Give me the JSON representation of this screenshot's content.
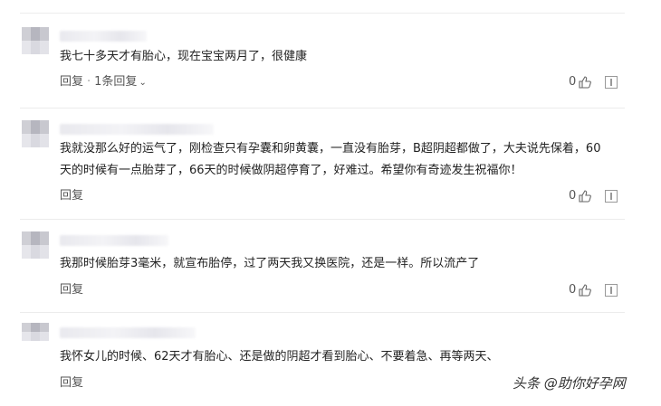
{
  "comments": [
    {
      "text": "我七十多天才有胎心，现在宝宝两月了，很健康",
      "reply_label": "回复",
      "replies_label": "1条回复",
      "likes": "0"
    },
    {
      "text": "我就没那么好的运气了，刚检查只有孕囊和卵黄囊，一直没有胎芽，B超阴超都做了，大夫说先保着，60天的时候有一点胎芽了，66天的时候做阴超停育了，好难过。希望你有奇迹发生祝福你！",
      "reply_label": "回复",
      "likes": "0"
    },
    {
      "text": "我那时候胎芽3毫米，就宣布胎停，过了两天我又换医院，还是一样。所以流产了",
      "reply_label": "回复",
      "likes": "0"
    },
    {
      "text": "我怀女儿的时候、62天才有胎心、还是做的阴超才看到胎心、不要着急、再等两天、",
      "reply_label": "回复"
    }
  ],
  "watermark": "头条 @助你好孕网",
  "icons": {
    "like": "thumbs-up-icon",
    "report": "report-icon",
    "expand": "chevron-down-icon"
  }
}
